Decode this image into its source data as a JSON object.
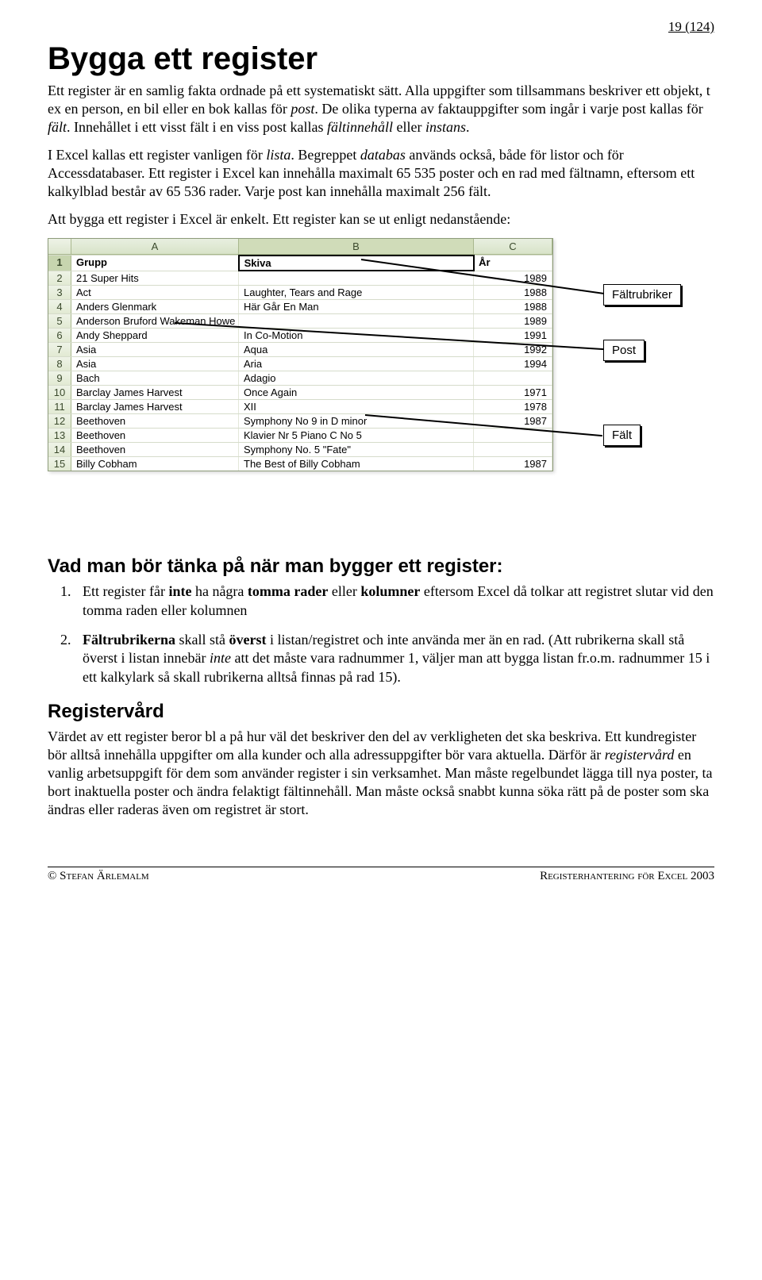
{
  "page_number": "19 (124)",
  "title": "Bygga ett register",
  "intro": {
    "p1a": "Ett register är en samlig fakta ordnade på ett systematiskt sätt. Alla uppgifter som tillsammans beskriver ett objekt, t ex en person, en bil eller en bok kallas för ",
    "p1_post": "post",
    "p1b": ". De olika typerna av faktauppgifter som ingår i varje post kallas för ",
    "p1_falt": "fält",
    "p1c": ". Innehållet i ett visst fält i en viss post kallas ",
    "p1_fi": "fältinnehåll",
    "p1d": " eller ",
    "p1_inst": "instans",
    "p1e": ".",
    "p2a": "I Excel kallas ett register vanligen för ",
    "p2_lista": "lista",
    "p2b": ". Begreppet ",
    "p2_db": "databas",
    "p2c": " används också, både för listor och för Accessdatabaser. Ett register i Excel kan innehålla maximalt 65 535 poster och en rad med fältnamn, eftersom ett kalkylblad består av 65 536 rader. Varje post kan innehålla maximalt 256 fält.",
    "p3": "Att bygga ett register i Excel är enkelt. Ett register kan se ut enligt nedanstående:"
  },
  "screenshot": {
    "col_labels": {
      "A": "A",
      "B": "B",
      "C": "C"
    },
    "headers": {
      "A": "Grupp",
      "B": "Skiva",
      "C": "År"
    },
    "rows": [
      {
        "n": "2",
        "A": "21 Super Hits",
        "B": "",
        "C": "1989"
      },
      {
        "n": "3",
        "A": "Act",
        "B": "Laughter, Tears and Rage",
        "C": "1988"
      },
      {
        "n": "4",
        "A": "Anders Glenmark",
        "B": "Här Går En Man",
        "C": "1988"
      },
      {
        "n": "5",
        "A": "Anderson Bruford Wakeman Howe",
        "B": "",
        "C": "1989"
      },
      {
        "n": "6",
        "A": "Andy Sheppard",
        "B": "In Co-Motion",
        "C": "1991"
      },
      {
        "n": "7",
        "A": "Asia",
        "B": "Aqua",
        "C": "1992"
      },
      {
        "n": "8",
        "A": "Asia",
        "B": "Aria",
        "C": "1994"
      },
      {
        "n": "9",
        "A": "Bach",
        "B": "Adagio",
        "C": ""
      },
      {
        "n": "10",
        "A": "Barclay James Harvest",
        "B": "Once Again",
        "C": "1971"
      },
      {
        "n": "11",
        "A": "Barclay James Harvest",
        "B": "XII",
        "C": "1978"
      },
      {
        "n": "12",
        "A": "Beethoven",
        "B": "Symphony No 9 in D minor",
        "C": "1987"
      },
      {
        "n": "13",
        "A": "Beethoven",
        "B": "Klavier Nr 5 Piano C No 5",
        "C": ""
      },
      {
        "n": "14",
        "A": "Beethoven",
        "B": "Symphony No. 5 \"Fate\"",
        "C": ""
      },
      {
        "n": "15",
        "A": "Billy Cobham",
        "B": "The Best of Billy Cobham",
        "C": "1987"
      }
    ]
  },
  "callouts": {
    "fieldheaders": "Fältrubriker",
    "post": "Post",
    "field": "Fält"
  },
  "tips": {
    "heading": "Vad man bör tänka på när man bygger ett register:",
    "t1a": "Ett register får ",
    "t1_inte": "inte",
    "t1b": " ha några ",
    "t1_tomma": "tomma rader",
    "t1c": " eller ",
    "t1_kol": "kolumner",
    "t1d": " eftersom Excel då tolkar att registret slutar vid den tomma raden eller kolumnen",
    "t2a": "Fältrubrikerna",
    "t2b": " skall stå ",
    "t2_over": "överst",
    "t2c": " i listan/registret och inte använda mer än en rad. (Att rubrikerna skall stå överst i listan innebär ",
    "t2_inte": "inte",
    "t2d": " att det måste vara radnummer 1, väljer man att bygga listan fr.o.m. radnummer 15 i ett kalkylark så skall rubrikerna alltså finnas på rad 15)."
  },
  "regvard": {
    "heading": "Registervård",
    "p1a": "Värdet av ett register beror bl a på hur väl det beskriver den del av verkligheten det ska beskriva. Ett kundregister bör alltså innehålla uppgifter om alla kunder och alla adressuppgifter bör vara aktuella. Därför är ",
    "p1_rv": "registervård",
    "p1b": " en vanlig arbetsuppgift för dem som använder register i sin verksamhet. Man måste regelbundet lägga till nya poster, ta bort inaktuella poster och ändra felaktigt fältinnehåll. Man måste också snabbt kunna söka rätt på de poster som ska ändras eller raderas även om registret är stort."
  },
  "footer": {
    "left": "© Stefan Ärlemalm",
    "right": "Registerhantering för Excel 2003"
  }
}
